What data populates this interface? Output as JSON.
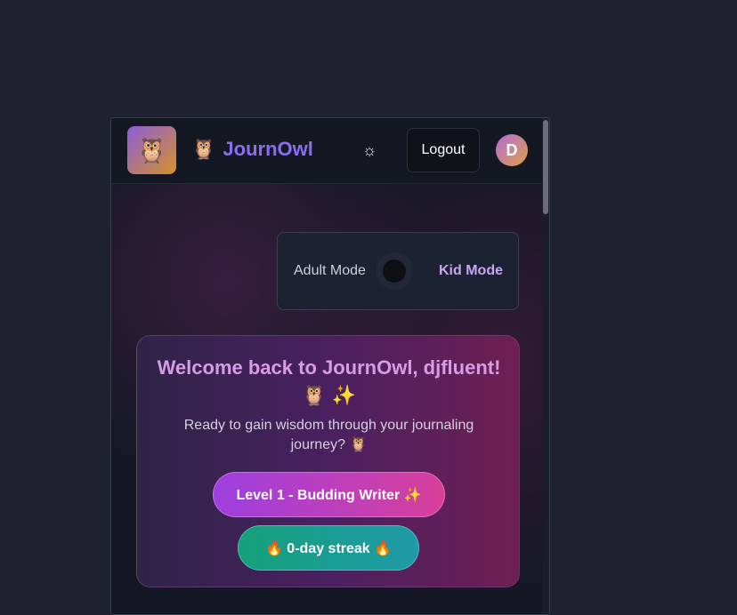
{
  "header": {
    "logo_emoji": "🦉",
    "brand_icon": "🦉",
    "brand_name": "JournOwl",
    "theme_icon": "☼",
    "logout_label": "Logout",
    "avatar_initial": "D"
  },
  "mode_toggle": {
    "adult_label": "Adult Mode",
    "kid_label": "Kid Mode",
    "current": "adult"
  },
  "welcome": {
    "title": "Welcome back to JournOwl, djfluent! 🦉 ✨",
    "subtitle": "Ready to gain wisdom through your journaling journey? 🦉",
    "level_label": "Level 1 - Budding Writer ✨",
    "streak_label": "🔥 0-day streak 🔥"
  },
  "colors": {
    "brand": "#8c6cf0",
    "page_bg": "#1e2230",
    "panel_bg": "#141825",
    "level_gradient_start": "#9d3fe0",
    "level_gradient_end": "#d83f9a",
    "streak_gradient_start": "#15a07a",
    "streak_gradient_end": "#1f9aa8"
  }
}
